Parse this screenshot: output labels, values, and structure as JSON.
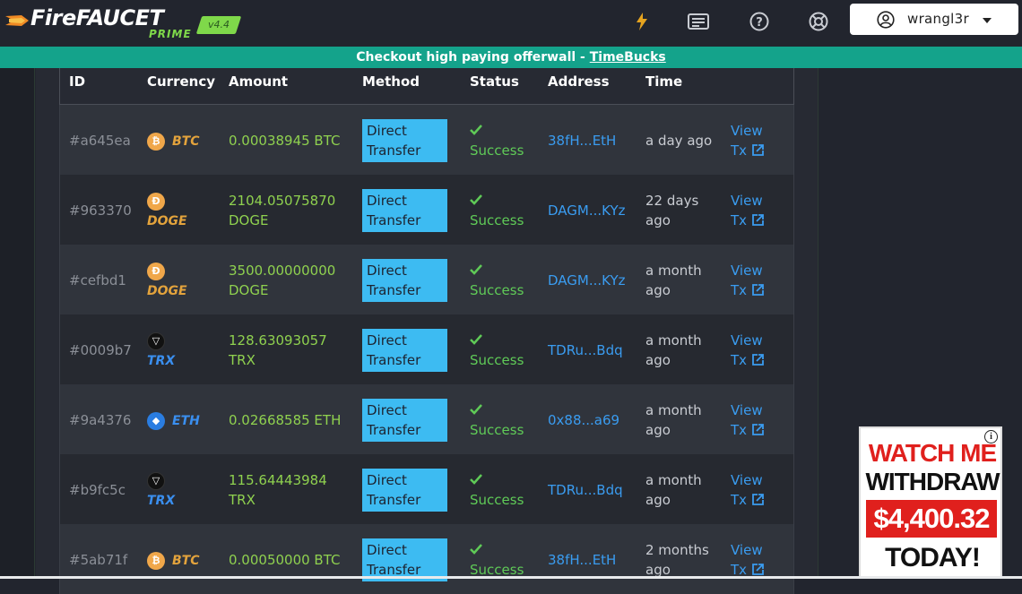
{
  "header": {
    "logo_fire": "Fire",
    "logo_faucet": "FAUCET",
    "logo_prime": "PRIME",
    "logo_version": "v4.4",
    "username": "wrangl3r",
    "icons": [
      "lightning-icon",
      "card-icon",
      "help-icon",
      "lifebuoy-icon",
      "user-icon"
    ]
  },
  "banner": {
    "text": "Checkout high paying offerwall - ",
    "link": "TimeBucks"
  },
  "table": {
    "columns": [
      "ID",
      "Currency",
      "Amount",
      "Method",
      "Status",
      "Address",
      "Time"
    ],
    "rows": [
      {
        "id": "#a645ea",
        "coin": "btc",
        "coin_symbol": "₿",
        "currency": "BTC",
        "amount_1": "0.00038945 BTC",
        "amount_2": "",
        "method_1": "Direct",
        "method_2": "Transfer",
        "status": "Success",
        "address": "38fH...EtH",
        "time_1": "a day ago",
        "time_2": "",
        "view_1": "View",
        "view_2": "Tx"
      },
      {
        "id": "#963370",
        "coin": "doge",
        "coin_symbol": "Ð",
        "currency": "DOGE",
        "amount_1": "2104.05075870",
        "amount_2": "DOGE",
        "method_1": "Direct",
        "method_2": "Transfer",
        "status": "Success",
        "address": "DAGM...KYz",
        "time_1": "22 days",
        "time_2": "ago",
        "view_1": "View",
        "view_2": "Tx"
      },
      {
        "id": "#cefbd1",
        "coin": "doge",
        "coin_symbol": "Ð",
        "currency": "DOGE",
        "amount_1": "3500.00000000",
        "amount_2": "DOGE",
        "method_1": "Direct",
        "method_2": "Transfer",
        "status": "Success",
        "address": "DAGM...KYz",
        "time_1": "a month",
        "time_2": "ago",
        "view_1": "View",
        "view_2": "Tx"
      },
      {
        "id": "#0009b7",
        "coin": "trx",
        "coin_symbol": "▽",
        "currency": "TRX",
        "amount_1": "128.63093057",
        "amount_2": "TRX",
        "method_1": "Direct",
        "method_2": "Transfer",
        "status": "Success",
        "address": "TDRu...Bdq",
        "time_1": "a month",
        "time_2": "ago",
        "view_1": "View",
        "view_2": "Tx"
      },
      {
        "id": "#9a4376",
        "coin": "eth",
        "coin_symbol": "◆",
        "currency": "ETH",
        "amount_1": "0.02668585 ETH",
        "amount_2": "",
        "method_1": "Direct",
        "method_2": "Transfer",
        "status": "Success",
        "address": "0x88...a69",
        "time_1": "a month",
        "time_2": "ago",
        "view_1": "View",
        "view_2": "Tx"
      },
      {
        "id": "#b9fc5c",
        "coin": "trx",
        "coin_symbol": "▽",
        "currency": "TRX",
        "amount_1": "115.64443984",
        "amount_2": "TRX",
        "method_1": "Direct",
        "method_2": "Transfer",
        "status": "Success",
        "address": "TDRu...Bdq",
        "time_1": "a month",
        "time_2": "ago",
        "view_1": "View",
        "view_2": "Tx"
      },
      {
        "id": "#5ab71f",
        "coin": "btc",
        "coin_symbol": "₿",
        "currency": "BTC",
        "amount_1": "0.00050000 BTC",
        "amount_2": "",
        "method_1": "Direct",
        "method_2": "Transfer",
        "status": "Success",
        "address": "38fH...EtH",
        "time_1": "2 months",
        "time_2": "ago",
        "view_1": "View",
        "view_2": "Tx"
      }
    ]
  },
  "ad": {
    "line1": "WATCH ME",
    "line2": "WITHDRAW",
    "amount": "$4,400.32",
    "line4": "TODAY!",
    "info": "i"
  },
  "colors": {
    "background": "#22252e",
    "banner": "#14a38b",
    "method_badge": "#3dbbf2",
    "amount": "#8fd14f",
    "success": "#5fca57",
    "link": "#3a9cf0"
  }
}
